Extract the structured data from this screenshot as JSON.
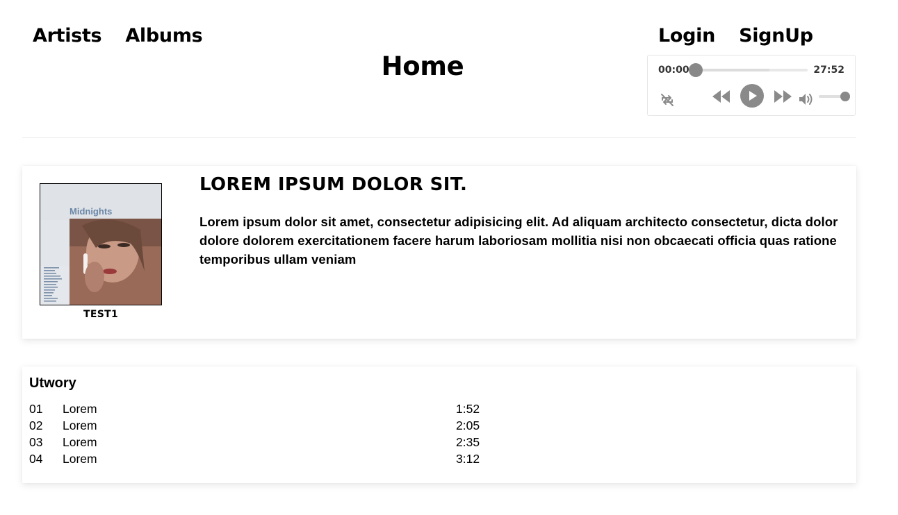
{
  "nav": {
    "left": [
      {
        "label": "Artists"
      },
      {
        "label": "Albums"
      }
    ],
    "right": [
      {
        "label": "Login"
      },
      {
        "label": "SignUp"
      }
    ]
  },
  "page": {
    "title": "Home"
  },
  "player": {
    "current_time": "00:00",
    "duration": "27:52",
    "progress_fraction": 0,
    "volume_fraction": 1,
    "icons": {
      "loop": "loop-icon",
      "rewind": "rewind-icon",
      "play": "play-icon",
      "forward": "fast-forward-icon",
      "volume": "volume-icon"
    },
    "accent_color": "#888888"
  },
  "album": {
    "cover_caption": "TEST1",
    "cover_art_text": "Midnights",
    "title": "LOREM IPSUM DOLOR SIT.",
    "description": "Lorem ipsum dolor sit amet, consectetur adipisicing elit. Ad aliquam architecto consectetur, dicta dolor dolore dolorem exercitationem facere harum laboriosam mollitia nisi non obcaecati officia quas ratione temporibus ullam veniam"
  },
  "tracks": {
    "heading": "Utwory",
    "items": [
      {
        "number": "01",
        "name": "Lorem",
        "duration": "1:52"
      },
      {
        "number": "02",
        "name": "Lorem",
        "duration": "2:05"
      },
      {
        "number": "03",
        "name": "Lorem",
        "duration": "2:35"
      },
      {
        "number": "04",
        "name": "Lorem",
        "duration": "3:12"
      }
    ]
  }
}
